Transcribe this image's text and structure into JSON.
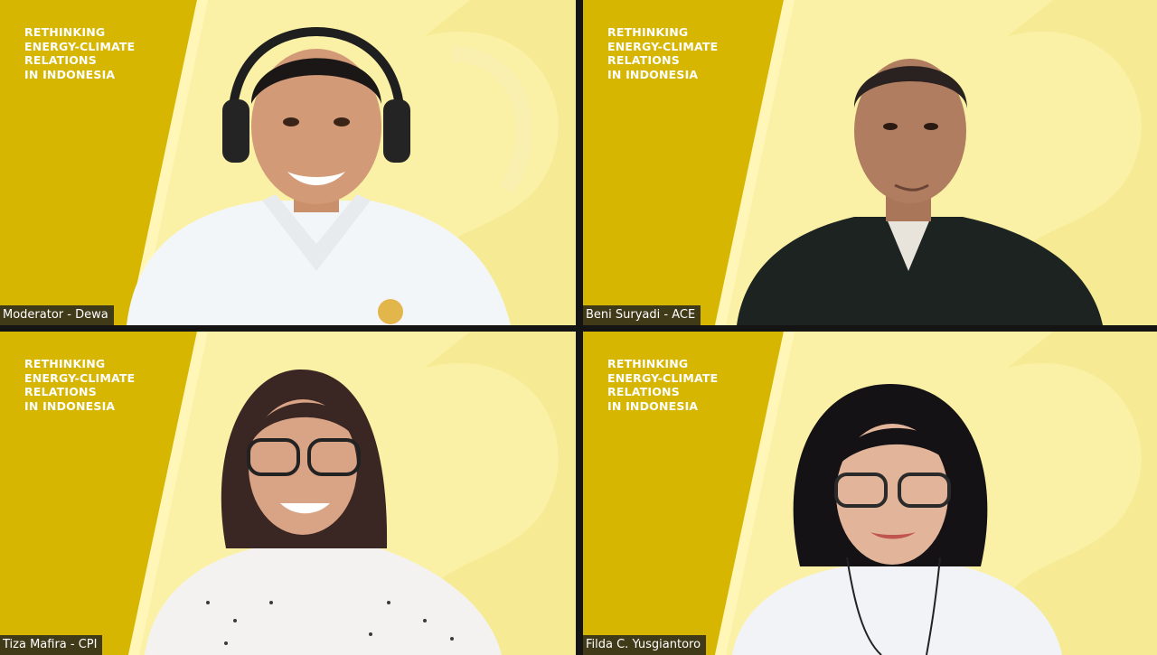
{
  "banner": {
    "lines": [
      "RETHINKING",
      "ENERGY-CLIMATE",
      "RELATIONS",
      "IN INDONESIA"
    ]
  },
  "colors": {
    "panel_yellow": "#d6b600",
    "background_yellow": "#fbf1a6",
    "name_tag_bg": "#1e1e1e"
  },
  "participants": [
    {
      "name": "Moderator - Dewa"
    },
    {
      "name": "Beni Suryadi - ACE"
    },
    {
      "name": "Tiza Mafira - CPI"
    },
    {
      "name": "Filda C. Yusgiantoro"
    }
  ]
}
